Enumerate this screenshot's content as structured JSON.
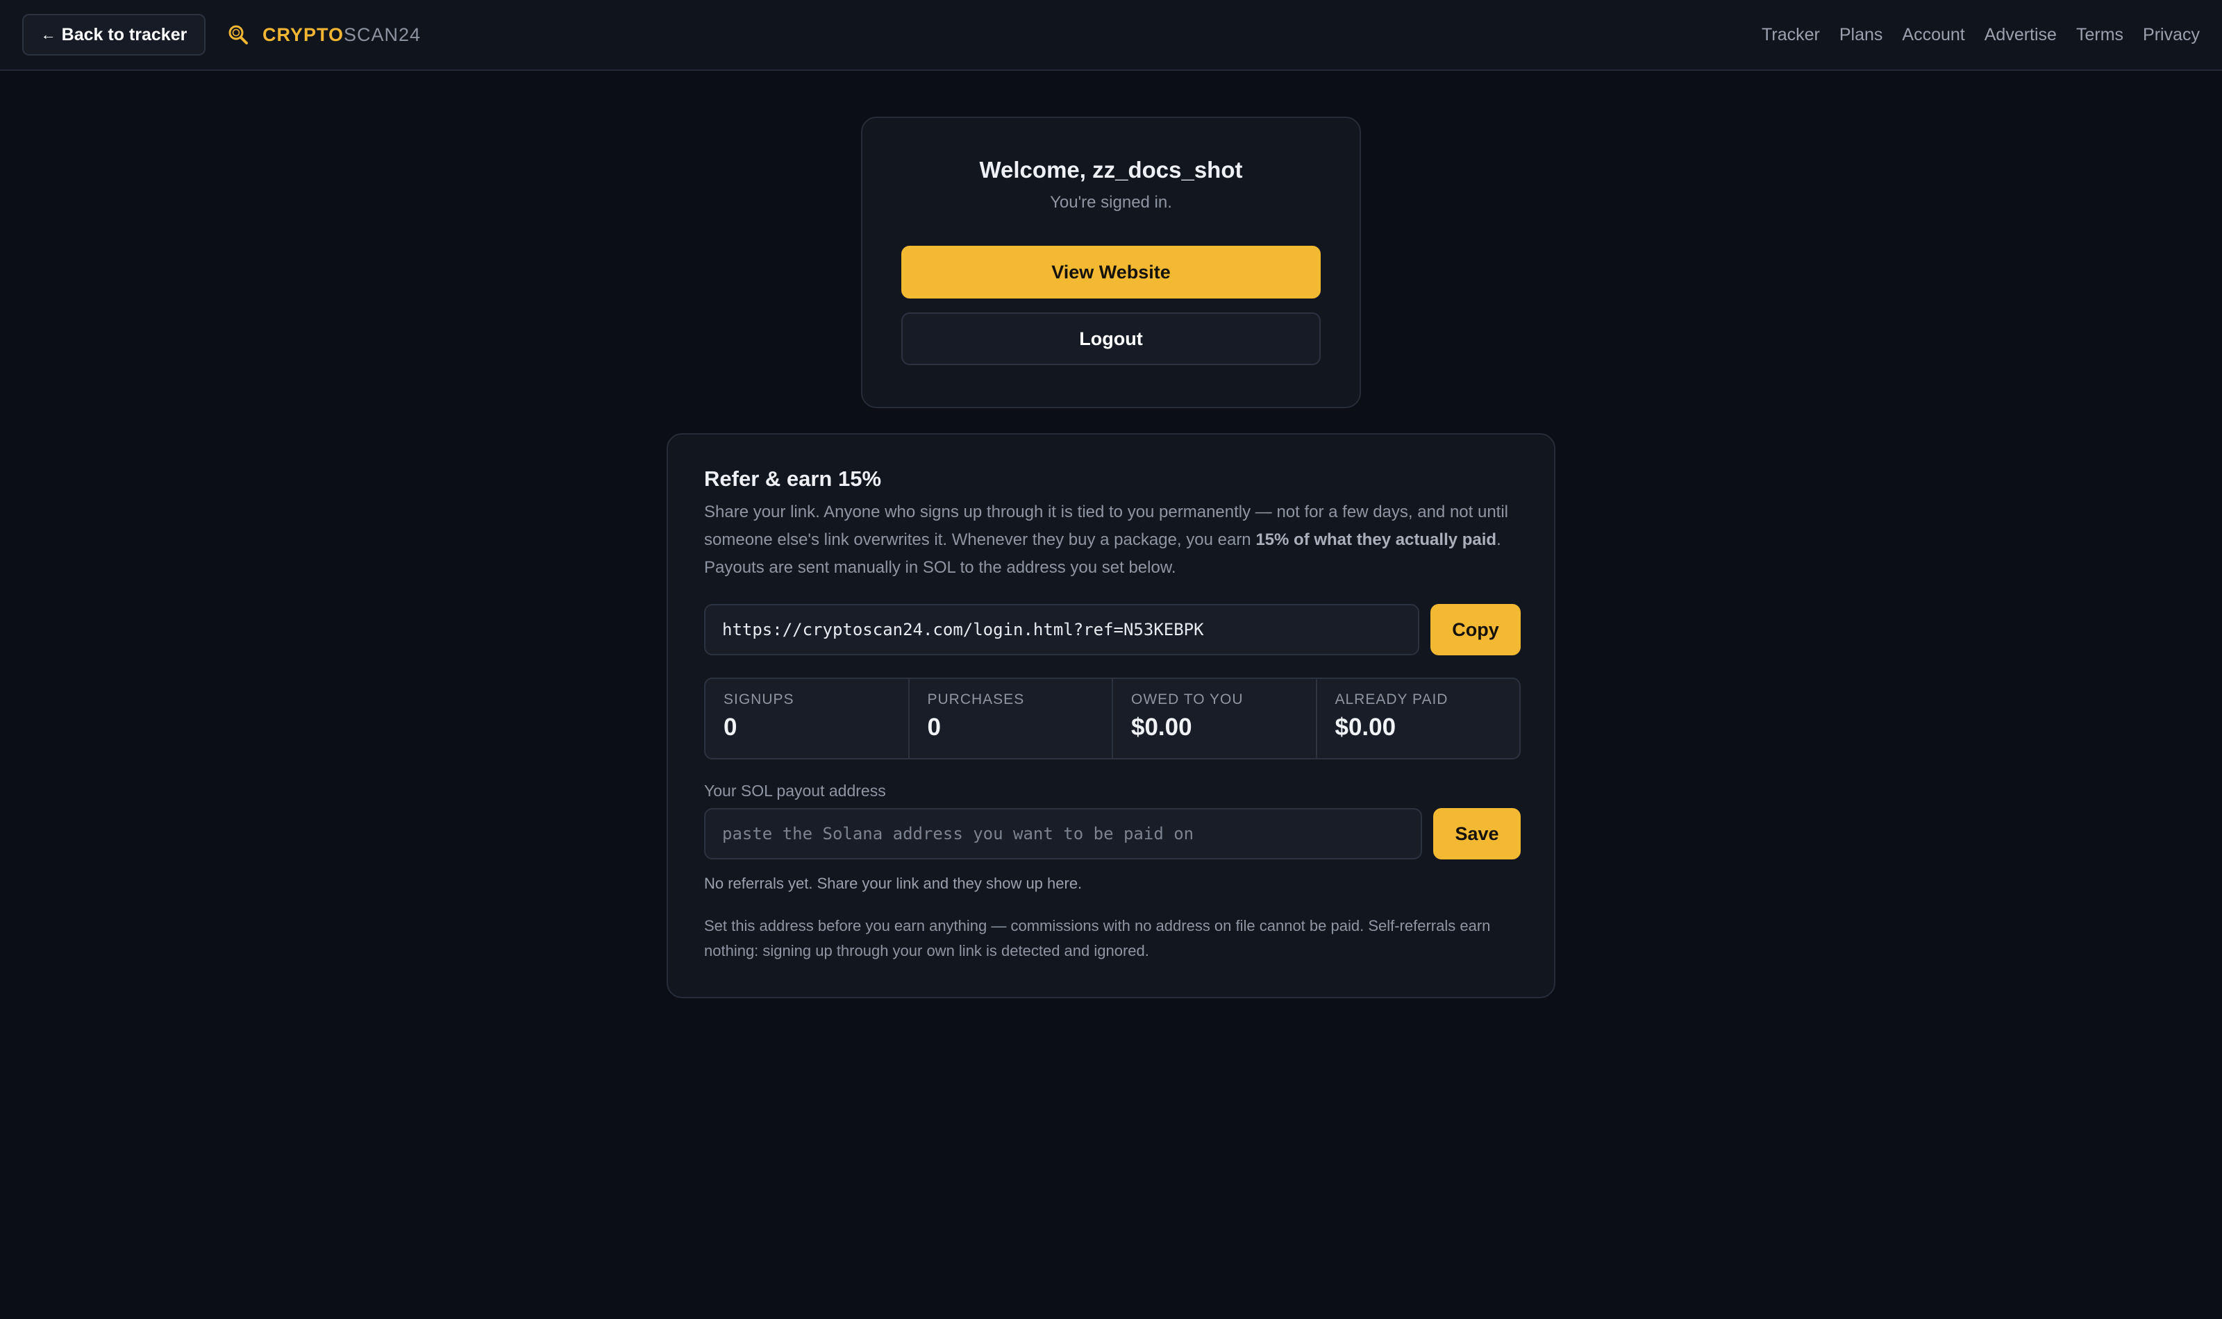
{
  "header": {
    "back_label": "Back to tracker",
    "back_arrow": "←",
    "brand_part1": "CRYPTO",
    "brand_part2": "SCAN24",
    "brand_icon": "magnifier-coin-icon",
    "nav": [
      "Tracker",
      "Plans",
      "Account",
      "Advertise",
      "Terms",
      "Privacy"
    ]
  },
  "welcome": {
    "title": "Welcome, zz_docs_shot",
    "subtitle": "You're signed in.",
    "primary_button": "View Website",
    "secondary_button": "Logout"
  },
  "referral": {
    "title": "Refer & earn 15%",
    "desc_part1": "Share your link. Anyone who signs up through it is tied to you permanently — not for a few days, and not until someone else's link overwrites it. Whenever they buy a package, you earn ",
    "desc_bold": "15% of what they actually paid",
    "desc_part2": ". Payouts are sent manually in SOL to the address you set below.",
    "link": "https://cryptoscan24.com/login.html?ref=N53KEBPK",
    "copy_label": "Copy",
    "stats": [
      {
        "label": "SIGNUPS",
        "value": "0"
      },
      {
        "label": "PURCHASES",
        "value": "0"
      },
      {
        "label": "OWED TO YOU",
        "value": "$0.00"
      },
      {
        "label": "ALREADY PAID",
        "value": "$0.00"
      }
    ],
    "sol_label": "Your SOL payout address",
    "sol_placeholder": "paste the Solana address you want to be paid on",
    "save_label": "Save",
    "no_referrals": "No referrals yet. Share your link and they show up here.",
    "note": "Set this address before you earn anything — commissions with no address on file cannot be paid. Self-referrals earn nothing: signing up through your own link is detected and ignored."
  },
  "colors": {
    "accent": "#f4b932",
    "background": "#0b0e15",
    "card": "#12161f"
  }
}
